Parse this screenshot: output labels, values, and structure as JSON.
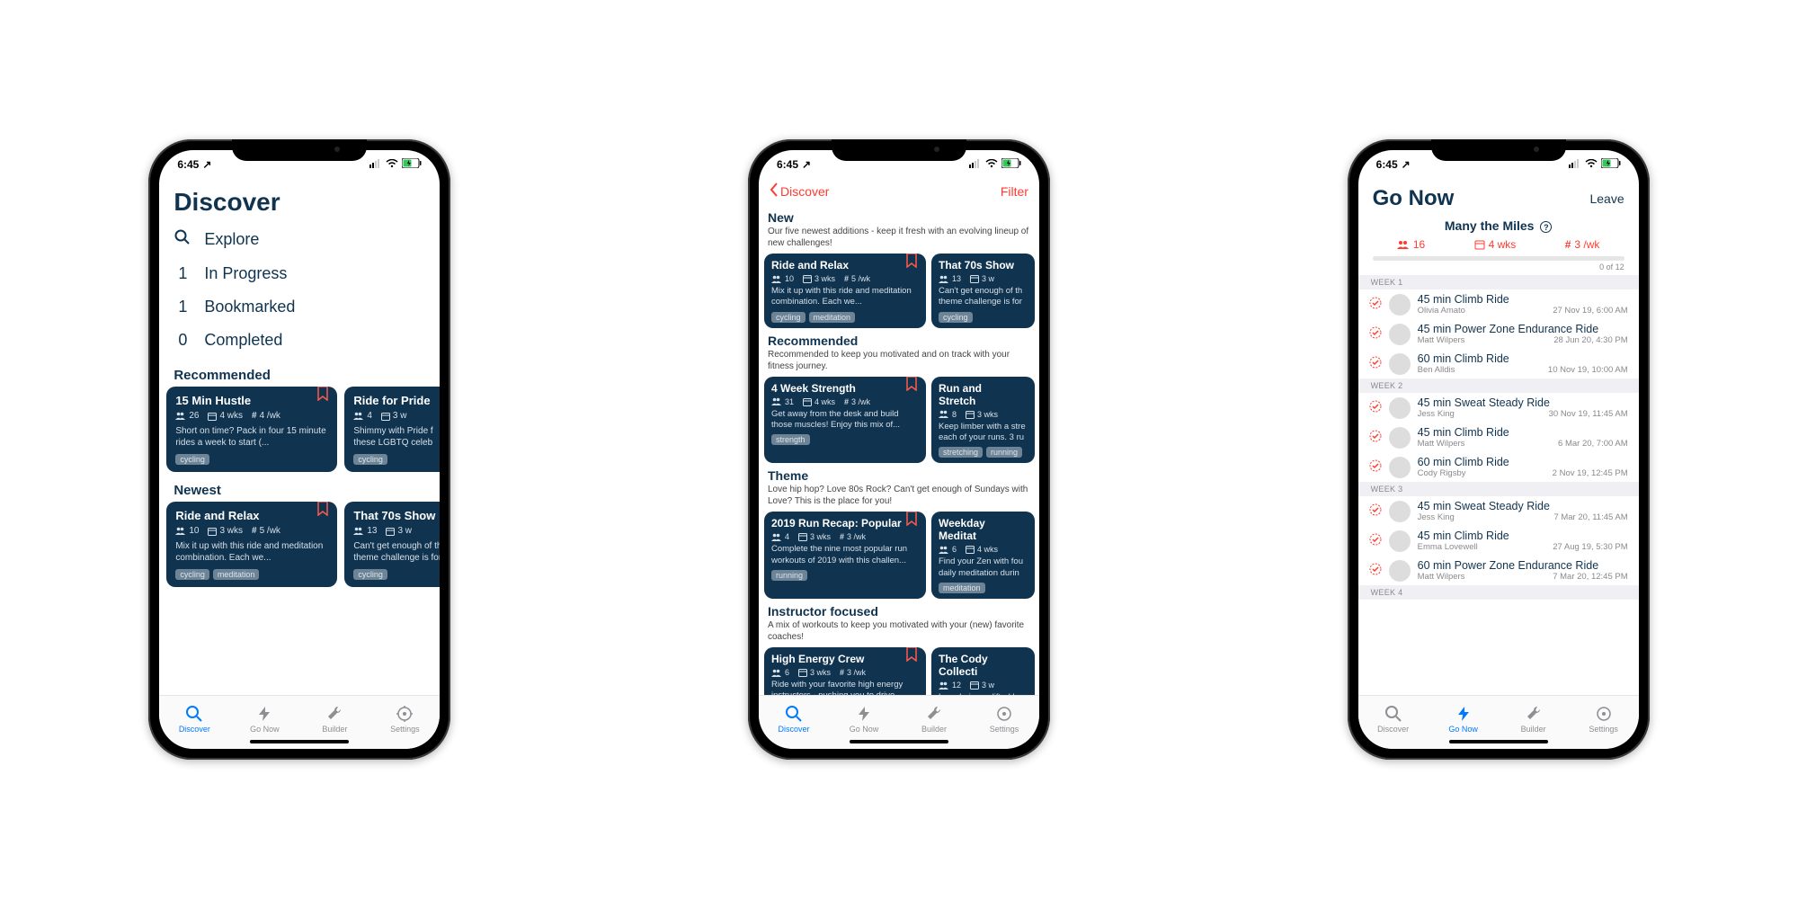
{
  "status": {
    "time": "6:45",
    "loc": "↗"
  },
  "tabs": [
    {
      "label": "Discover"
    },
    {
      "label": "Go Now"
    },
    {
      "label": "Builder"
    },
    {
      "label": "Settings"
    }
  ],
  "phone1": {
    "title": "Discover",
    "nav": [
      {
        "count": "",
        "label": "Explore",
        "is_icon": true
      },
      {
        "count": "1",
        "label": "In Progress"
      },
      {
        "count": "1",
        "label": "Bookmarked"
      },
      {
        "count": "0",
        "label": "Completed"
      }
    ],
    "recommended_title": "Recommended",
    "recommended": [
      {
        "title": "15 Min Hustle",
        "bookmarked": true,
        "people": "26",
        "duration": "4 wks",
        "freq": "4 /wk",
        "desc": "Short on time? Pack in four 15 minute rides a week to start (...",
        "tags": [
          "cycling"
        ]
      },
      {
        "title": "Ride for Pride",
        "bookmarked": false,
        "people": "4",
        "duration": "3 w",
        "freq": "",
        "desc": "Shimmy with Pride f these LGBTQ celeb",
        "tags": [
          "cycling"
        ]
      }
    ],
    "newest_title": "Newest",
    "newest": [
      {
        "title": "Ride and Relax",
        "bookmarked": true,
        "people": "10",
        "duration": "3 wks",
        "freq": "5 /wk",
        "desc": "Mix it up with this ride and meditation combination. Each we...",
        "tags": [
          "cycling",
          "meditation"
        ]
      },
      {
        "title": "That 70s Show",
        "bookmarked": false,
        "people": "13",
        "duration": "3 w",
        "freq": "",
        "desc": "Can't get enough of th theme challenge is for y",
        "tags": [
          "cycling"
        ]
      }
    ]
  },
  "phone2": {
    "back": "Discover",
    "filter": "Filter",
    "sections": [
      {
        "title": "New",
        "sub": "Our five newest additions - keep it fresh with an evolving lineup of new challenges!",
        "cards": [
          {
            "title": "Ride and Relax",
            "bookmarked": true,
            "people": "10",
            "duration": "3 wks",
            "freq": "5 /wk",
            "desc": "Mix it up with this ride and meditation combination. Each we...",
            "tags": [
              "cycling",
              "meditation"
            ]
          },
          {
            "title": "That 70s Show",
            "bookmarked": false,
            "people": "13",
            "duration": "3 w",
            "freq": "",
            "desc": "Can't get enough of th theme challenge is for",
            "tags": [
              "cycling"
            ]
          }
        ]
      },
      {
        "title": "Recommended",
        "sub": "Recommended to keep you motivated and on track with your fitness journey.",
        "cards": [
          {
            "title": "4 Week Strength",
            "bookmarked": true,
            "people": "31",
            "duration": "4 wks",
            "freq": "3 /wk",
            "desc": "Get away from the desk and build those muscles! Enjoy this mix of...",
            "tags": [
              "strength"
            ]
          },
          {
            "title": "Run and Stretch",
            "bookmarked": false,
            "people": "8",
            "duration": "3 wks",
            "freq": "",
            "desc": "Keep limber with a stre each of your runs. 3 ru",
            "tags": [
              "stretching",
              "running"
            ]
          }
        ]
      },
      {
        "title": "Theme",
        "sub": "Love hip hop? Love 80s Rock? Can't get enough of Sundays with Love? This is the place for you!",
        "cards": [
          {
            "title": "2019 Run Recap: Popular",
            "bookmarked": true,
            "people": "4",
            "duration": "3 wks",
            "freq": "3 /wk",
            "desc": "Complete the nine most popular run workouts of 2019 with this challen...",
            "tags": [
              "running"
            ]
          },
          {
            "title": "Weekday Meditat",
            "bookmarked": false,
            "people": "6",
            "duration": "4 wks",
            "freq": "",
            "desc": "Find your Zen with fou daily meditation durin",
            "tags": [
              "meditation"
            ]
          }
        ]
      },
      {
        "title": "Instructor focused",
        "sub": "A mix of workouts to keep you motivated with your (new) favorite coaches!",
        "cards": [
          {
            "title": "High Energy Crew",
            "bookmarked": true,
            "people": "6",
            "duration": "3 wks",
            "freq": "3 /wk",
            "desc": "Ride with your favorite high energy instructors - pushing you to drive...",
            "tags": []
          },
          {
            "title": "The Cody Collecti",
            "bookmarked": false,
            "people": "12",
            "duration": "3 w",
            "freq": "",
            "desc": "Love being uplifted by through his greatest r",
            "tags": []
          }
        ]
      }
    ]
  },
  "phone3": {
    "title": "Go Now",
    "leave": "Leave",
    "subtitle": "Many the Miles",
    "stats": {
      "people": "16",
      "duration": "4 wks",
      "freq": "3 /wk"
    },
    "progress": "0 of 12",
    "weeks": [
      {
        "label": "WEEK 1",
        "items": [
          {
            "title": "45 min Climb Ride",
            "instructor": "Olivia Amato",
            "when": "27 Nov 19, 6:00 AM",
            "av": "av1"
          },
          {
            "title": "45 min Power Zone Endurance Ride",
            "instructor": "Matt Wilpers",
            "when": "28 Jun 20, 4:30 PM",
            "av": "av2"
          },
          {
            "title": "60 min Climb Ride",
            "instructor": "Ben Alldis",
            "when": "10 Nov 19, 10:00 AM",
            "av": "av3"
          }
        ]
      },
      {
        "label": "WEEK 2",
        "items": [
          {
            "title": "45 min Sweat Steady Ride",
            "instructor": "Jess King",
            "when": "30 Nov 19, 11:45 AM",
            "av": "av4"
          },
          {
            "title": "45 min Climb Ride",
            "instructor": "Matt Wilpers",
            "when": "6 Mar 20, 7:00 AM",
            "av": "av2"
          },
          {
            "title": "60 min Climb Ride",
            "instructor": "Cody Rigsby",
            "when": "2 Nov 19, 12:45 PM",
            "av": "av5"
          }
        ]
      },
      {
        "label": "WEEK 3",
        "items": [
          {
            "title": "45 min Sweat Steady Ride",
            "instructor": "Jess King",
            "when": "7 Mar 20, 11:45 AM",
            "av": "av4"
          },
          {
            "title": "45 min Climb Ride",
            "instructor": "Emma Lovewell",
            "when": "27 Aug 19, 5:30 PM",
            "av": "av6"
          },
          {
            "title": "60 min Power Zone Endurance Ride",
            "instructor": "Matt Wilpers",
            "when": "7 Mar 20, 12:45 PM",
            "av": "av2"
          }
        ]
      },
      {
        "label": "WEEK 4",
        "items": []
      }
    ]
  }
}
